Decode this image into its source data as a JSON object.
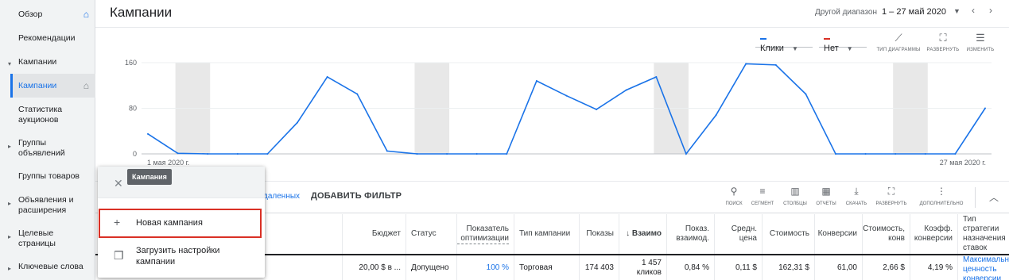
{
  "sidebar": {
    "overview": "Обзор",
    "recommendations": "Рекомендации",
    "campaigns_group": "Кампании",
    "campaigns": "Кампании",
    "auction_stats": "Статистика аукционов",
    "ad_groups": "Группы объявлений",
    "product_groups": "Группы товаров",
    "ads_ext": "Объявления и расширения",
    "landing_pages": "Целевые страницы",
    "keywords": "Ключевые слова"
  },
  "header": {
    "title": "Кампании",
    "date_label": "Другой диапазон",
    "date_value": "1 – 27 май 2020"
  },
  "chart_controls": {
    "metric1": "Клики",
    "metric1_color": "#1a73e8",
    "metric2": "Нет",
    "metric2_color": "#d93025",
    "chart_type": "тип диаграммы",
    "expand": "развернуть",
    "adjust": "изменить"
  },
  "chart_data": {
    "type": "line",
    "series": [
      {
        "name": "Клики",
        "values": [
          35,
          1,
          0,
          0,
          0,
          55,
          135,
          105,
          5,
          0,
          0,
          0,
          0,
          128,
          102,
          78,
          112,
          135,
          0,
          68,
          158,
          156,
          105,
          0,
          0,
          0,
          0,
          0,
          80
        ]
      }
    ],
    "ylim": [
      0,
      160
    ],
    "yticks": [
      "160",
      "80",
      "0"
    ],
    "x_start_label": "1 мая 2020 г.",
    "x_end_label": "27 мая 2020 г."
  },
  "filter": {
    "link_partial": "даленных",
    "add_filter": "ДОБАВИТЬ ФИЛЬТР"
  },
  "table_tools": [
    "поиск",
    "сегмент",
    "столбцы",
    "отчеты",
    "скачать",
    "развернуть",
    "дополнительно"
  ],
  "table": {
    "headers": {
      "budget": "Бюджет",
      "status": "Статус",
      "opt_score": "Показатель оптимизации",
      "camp_type": "Тип кампании",
      "impr": "Показы",
      "interactions": "↓ Взаимо",
      "inter_rate": "Показ. взаимод.",
      "avg_cost": "Средн. цена",
      "cost": "Стоимость",
      "conv": "Конверсии",
      "cost_conv": "Стоимость, конв",
      "conv_rate": "Коэфф. конверсии",
      "bid_strategy": "Тип стратегии назначения ставок"
    },
    "row": {
      "budget": "20,00 $ в ...",
      "status": "Допущено",
      "opt_score": "100 %",
      "camp_type": "Торговая",
      "impr": "174 403",
      "interactions": "1 457 кликов",
      "inter_rate": "0,84 %",
      "avg_cost": "0,11 $",
      "cost": "162,31 $",
      "conv": "61,00",
      "cost_conv": "2,66 $",
      "conv_rate": "4,19 %",
      "bid_strategy": "Максимальная ценность конверсии"
    }
  },
  "menu": {
    "tooltip": "Кампания",
    "new_campaign": "Новая кампания",
    "upload_settings": "Загрузить настройки кампании"
  }
}
